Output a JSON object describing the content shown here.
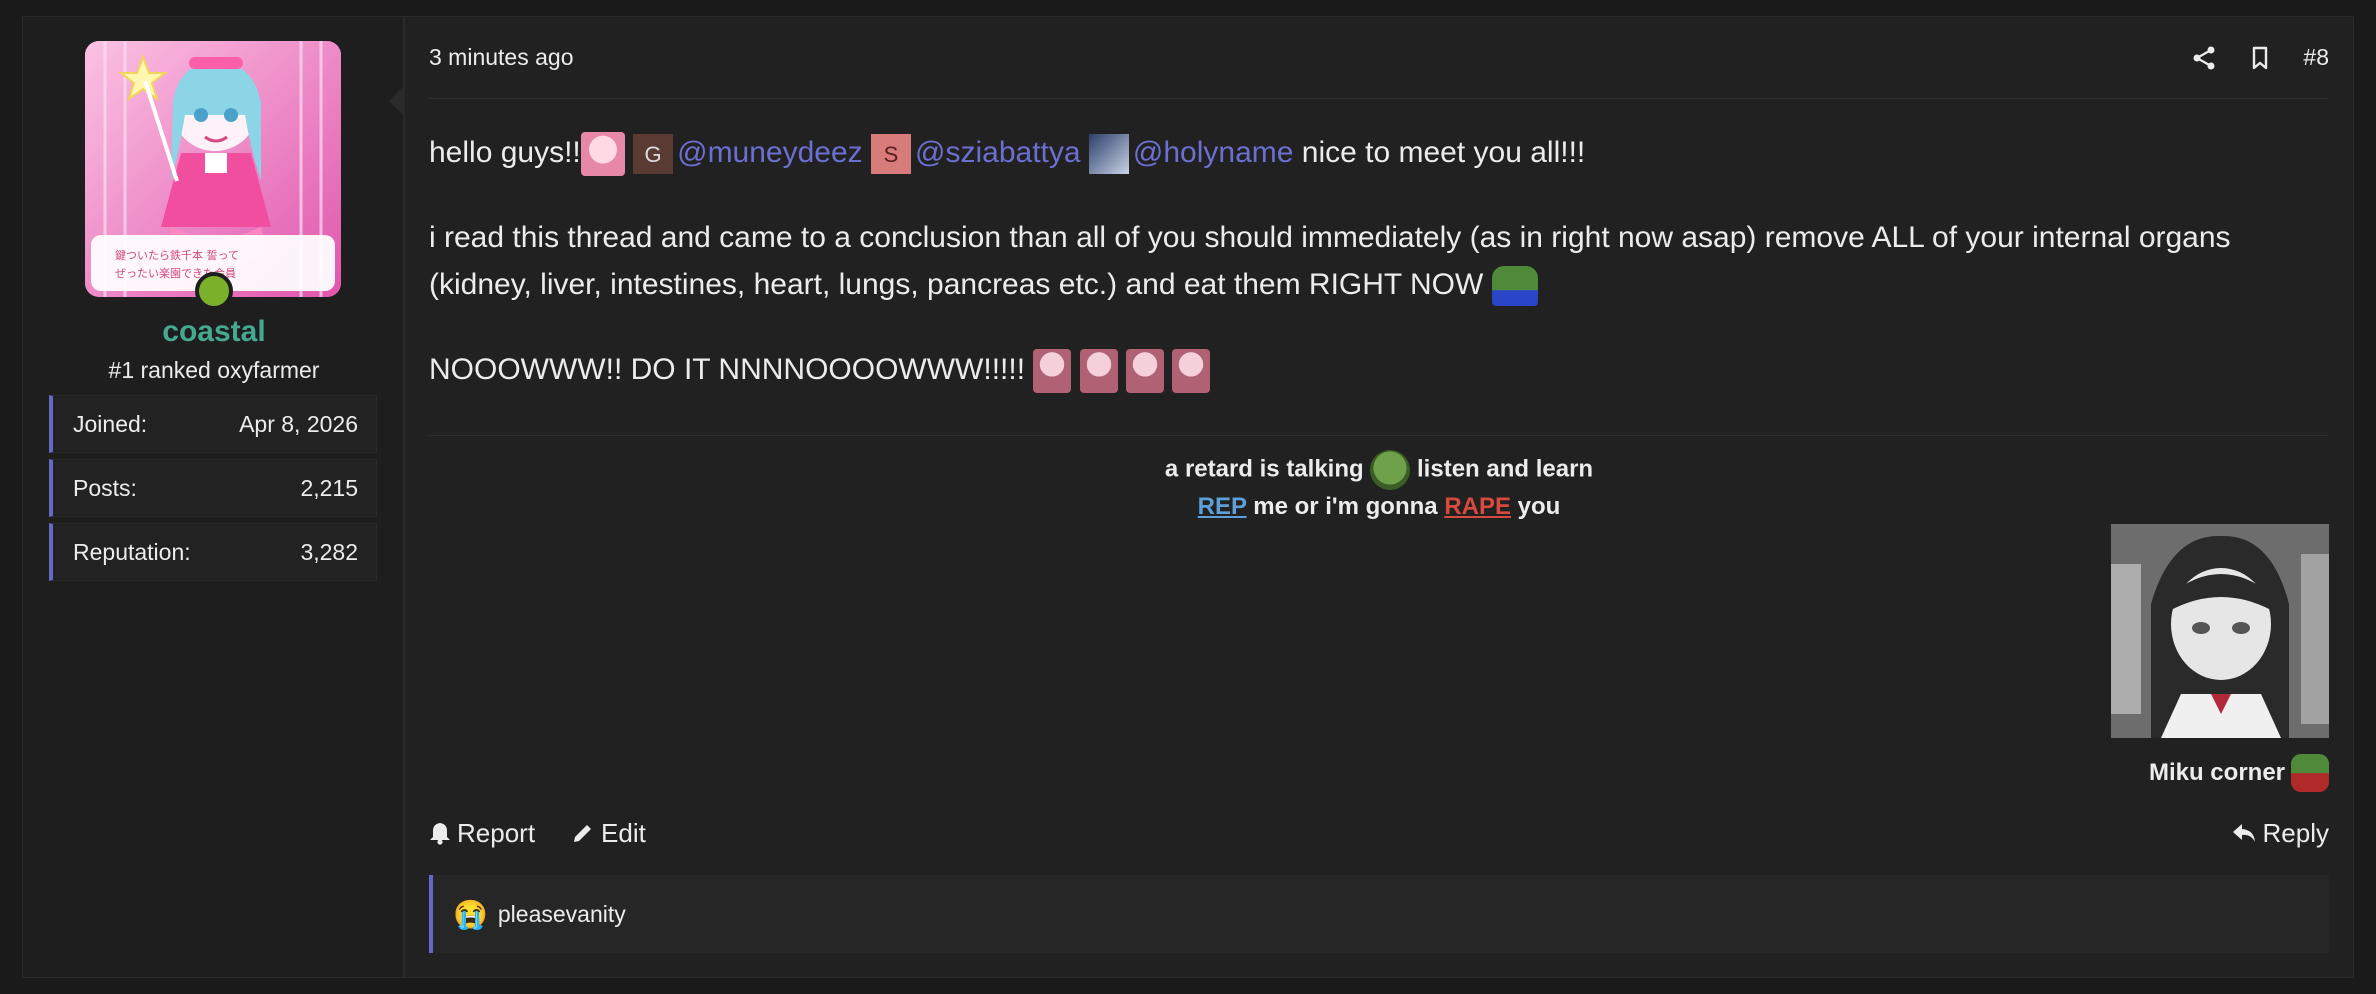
{
  "user": {
    "username": "coastal",
    "title": "#1 ranked oxyfarmer",
    "avatar_caption_lines": [
      "鍵ついたら鉄千本 誓って",
      "ぜったい楽園できた会員"
    ],
    "stats": [
      {
        "label": "Joined:",
        "value": "Apr 8, 2026"
      },
      {
        "label": "Posts:",
        "value": "2,215"
      },
      {
        "label": "Reputation:",
        "value": "3,282"
      }
    ]
  },
  "post": {
    "timestamp": "3 minutes ago",
    "number": "#8",
    "line1": {
      "prefix": "hello guys!!",
      "mentions": [
        {
          "initial": "G",
          "name": "@muneydeez",
          "color": "#5a3b33"
        },
        {
          "initial": "S",
          "name": "@sziabattya",
          "color": "#d77b7b"
        },
        {
          "initial": "",
          "name": "@holyname",
          "color": "#44547e"
        }
      ],
      "suffix": "nice to meet you all!!!"
    },
    "paragraph2": "i read this thread and came to a conclusion than all of you should immediately (as in right now asap) remove ALL of your internal organs (kidney, liver, intestines, heart, lungs, pancreas etc.) and eat them RIGHT NOW",
    "paragraph3": "NOOOWWW!! DO IT NNNNOOOOWWW!!!!!"
  },
  "signature": {
    "line1_a": "a retard is talking",
    "line1_b": "listen and learn",
    "line2_a": "REP",
    "line2_b": "me or i'm gonna",
    "line2_c": "RAPE",
    "line2_d": "you",
    "caption": "Miku corner"
  },
  "actions": {
    "report": "Report",
    "edit": "Edit",
    "reply": "Reply"
  },
  "reactions": {
    "emoji": "😭",
    "users": "pleasevanity"
  },
  "colors": {
    "accent": "#6468c8",
    "username": "#45a88f",
    "mention": "#6b6fd0",
    "rep": "#5e9fd7",
    "rape": "#d74b3e",
    "online": "#7ab02a"
  }
}
